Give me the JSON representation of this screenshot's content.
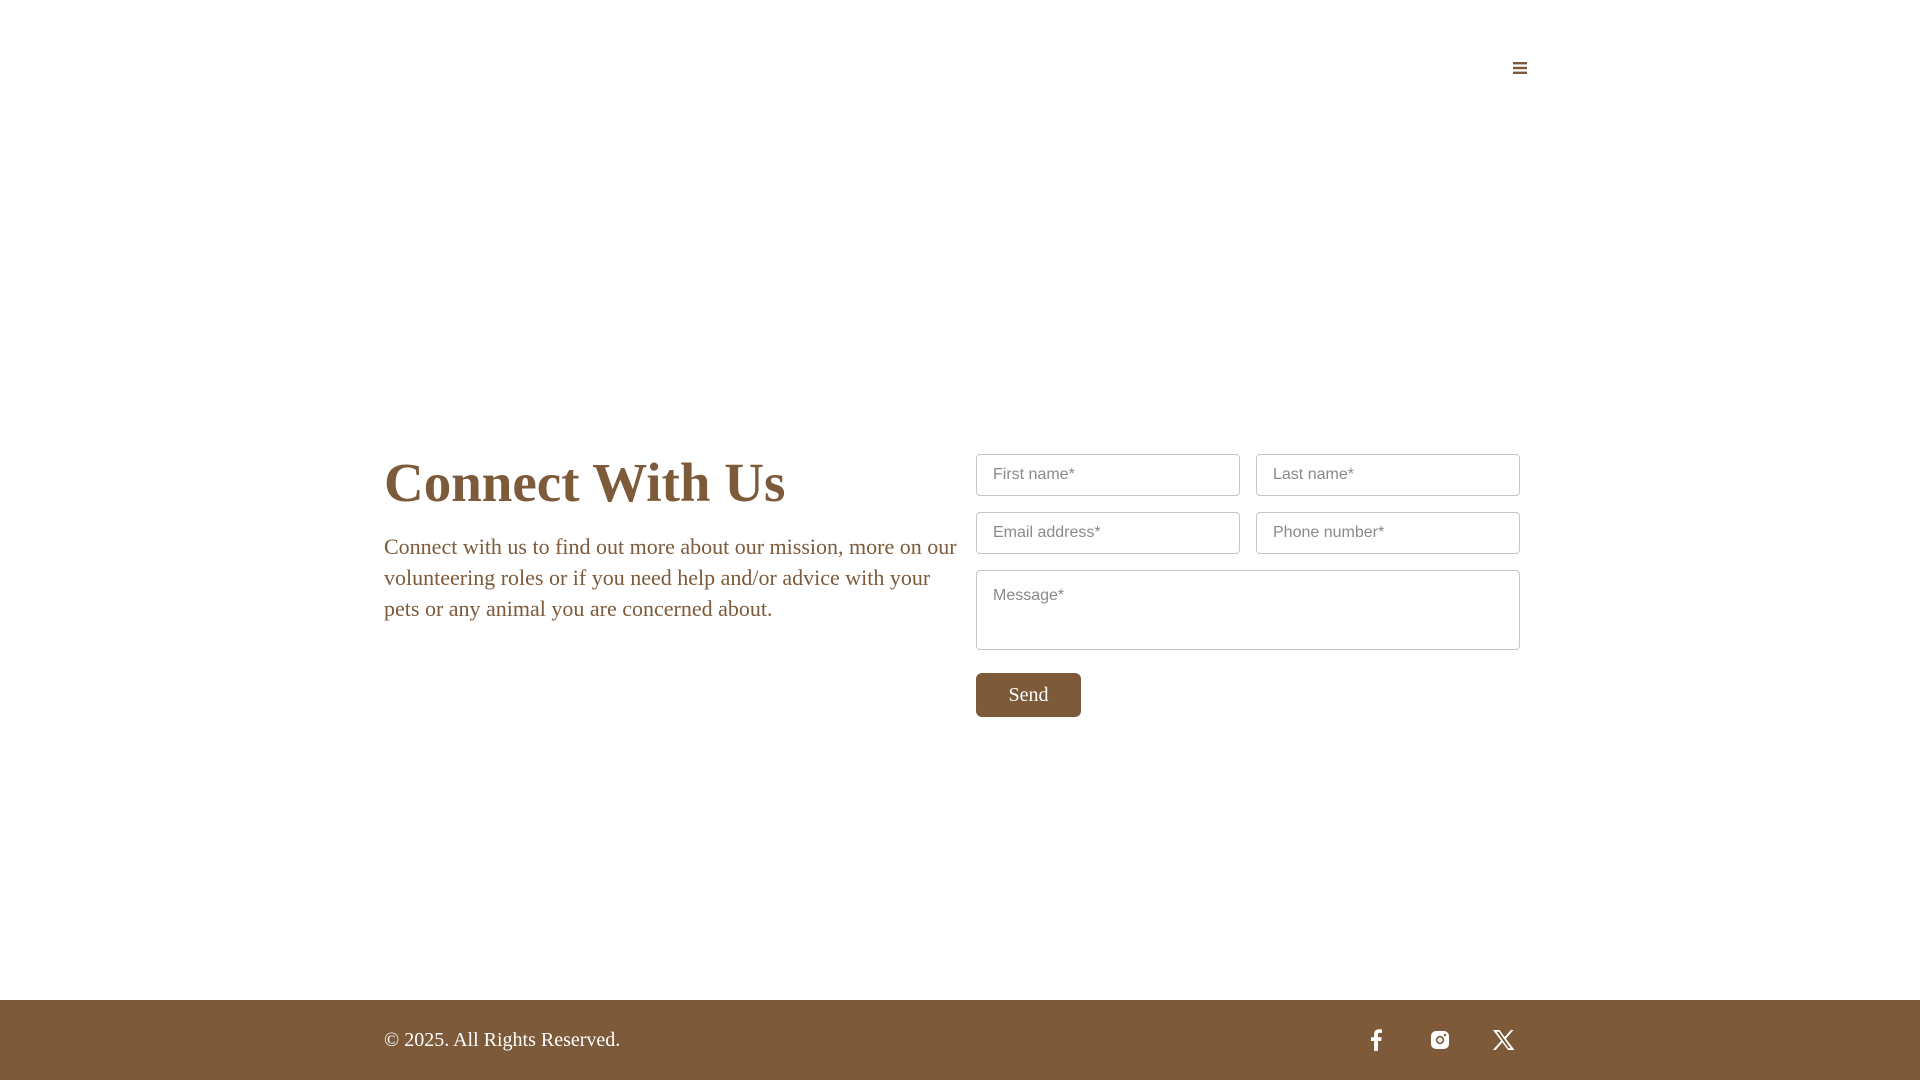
{
  "header": {
    "menu_icon": "hamburger-menu-icon"
  },
  "contact": {
    "title": "Connect With Us",
    "intro": "Connect with us to find out more about our mission, more on our volunteering roles or if you need help and/or advice with your pets or any animal you are concerned about."
  },
  "form": {
    "first_name": {
      "placeholder": "First name*",
      "value": ""
    },
    "last_name": {
      "placeholder": "Last name*",
      "value": ""
    },
    "email": {
      "placeholder": "Email address*",
      "value": ""
    },
    "phone": {
      "placeholder": "Phone number*",
      "value": ""
    },
    "message": {
      "placeholder": "Message*",
      "value": ""
    },
    "send_label": "Send"
  },
  "footer": {
    "copyright": "© 2025. All Rights Reserved.",
    "social": [
      {
        "icon": "facebook-icon"
      },
      {
        "icon": "instagram-icon"
      },
      {
        "icon": "x-icon"
      }
    ]
  },
  "colors": {
    "brand": "#7c5a3a",
    "background": "#ffffff",
    "input_border": "#c9c4bf",
    "placeholder": "#8a8a8a",
    "footer_text": "#ffffff"
  }
}
